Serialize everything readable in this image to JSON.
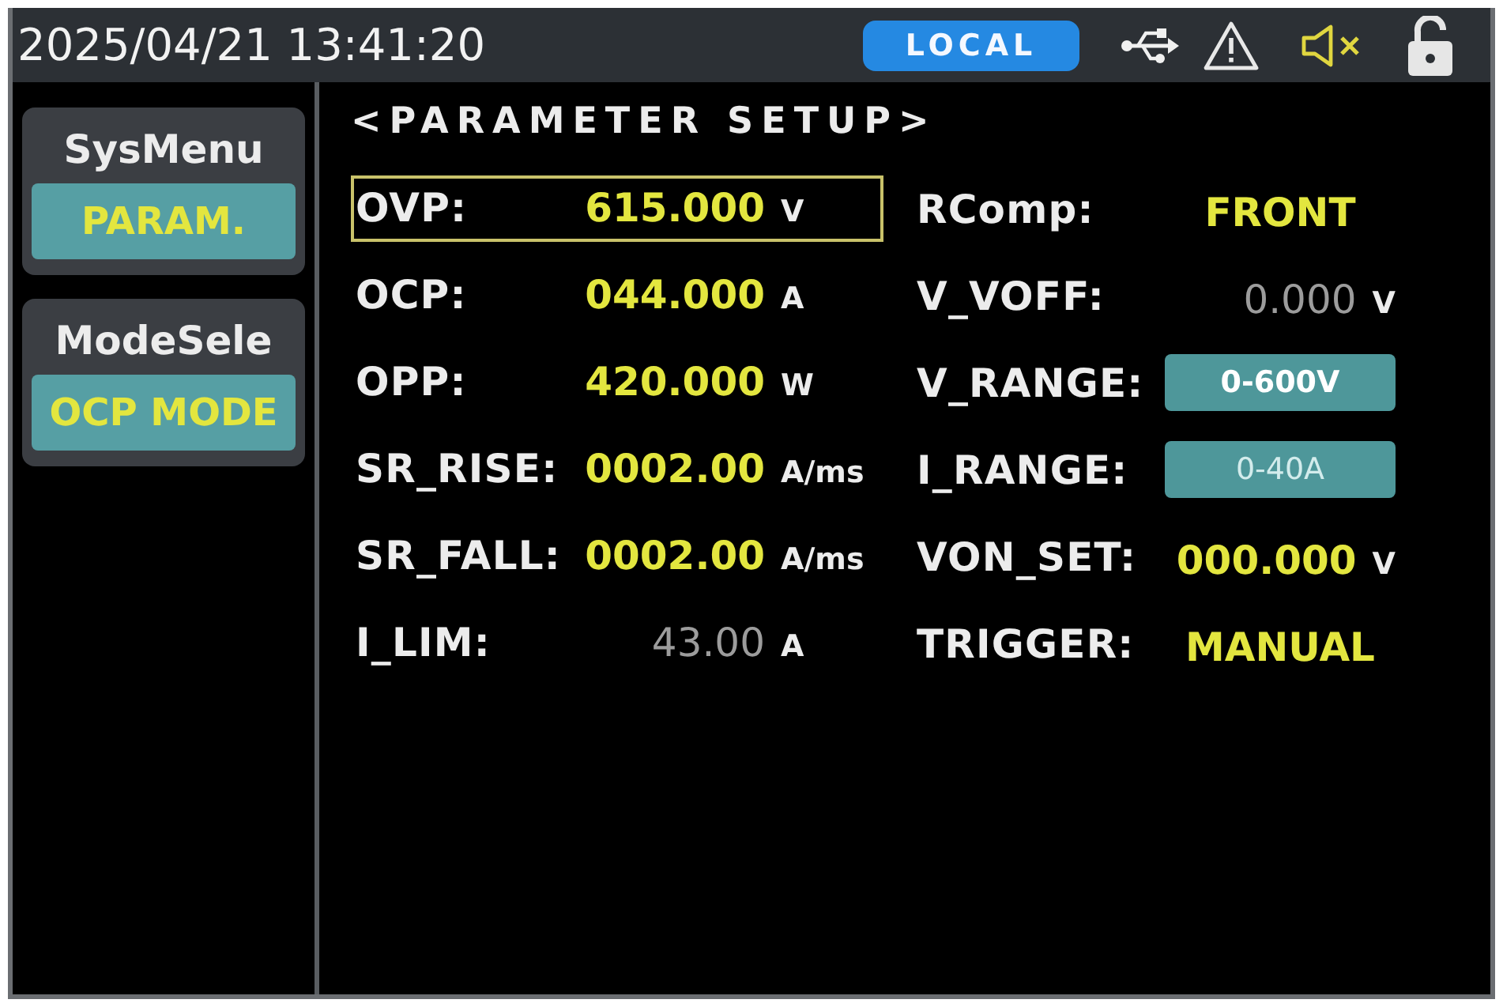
{
  "status_bar": {
    "datetime": "2025/04/21 13:41:20",
    "mode": "LOCAL",
    "muted": true,
    "locked": false
  },
  "sidebar": {
    "menus": [
      {
        "title": "SysMenu",
        "value": "PARAM."
      },
      {
        "title": "ModeSele",
        "value": "OCP MODE"
      }
    ]
  },
  "panel": {
    "title": "<PARAMETER SETUP>",
    "left_params": [
      {
        "label": "OVP:",
        "value": "615.000",
        "unit": "V",
        "selected": true,
        "disabled": false
      },
      {
        "label": "OCP:",
        "value": "044.000",
        "unit": "A",
        "selected": false,
        "disabled": false
      },
      {
        "label": "OPP:",
        "value": "420.000",
        "unit": "W",
        "selected": false,
        "disabled": false
      },
      {
        "label": "SR_RISE:",
        "value": "0002.00",
        "unit": "A/ms",
        "selected": false,
        "disabled": false
      },
      {
        "label": "SR_FALL:",
        "value": "0002.00",
        "unit": "A/ms",
        "selected": false,
        "disabled": false
      },
      {
        "label": "I_LIM:",
        "value": "43.00",
        "unit": "A",
        "selected": false,
        "disabled": true
      }
    ],
    "right_params": [
      {
        "kind": "text",
        "label": "RComp:",
        "value": "FRONT",
        "selected": false,
        "disabled": false
      },
      {
        "kind": "number",
        "label": "V_VOFF:",
        "value": "0.000",
        "unit": "V",
        "selected": false,
        "disabled": true
      },
      {
        "kind": "option",
        "label": "V_RANGE:",
        "value": "0-600V",
        "selected": false,
        "disabled": false
      },
      {
        "kind": "option",
        "label": "I_RANGE:",
        "value": "0-40A",
        "selected": false,
        "disabled": true
      },
      {
        "kind": "number",
        "label": "VON_SET:",
        "value": "000.000",
        "unit": "V",
        "selected": false,
        "disabled": false
      },
      {
        "kind": "text",
        "label": "TRIGGER:",
        "value": "MANUAL",
        "selected": false,
        "disabled": false
      }
    ]
  }
}
